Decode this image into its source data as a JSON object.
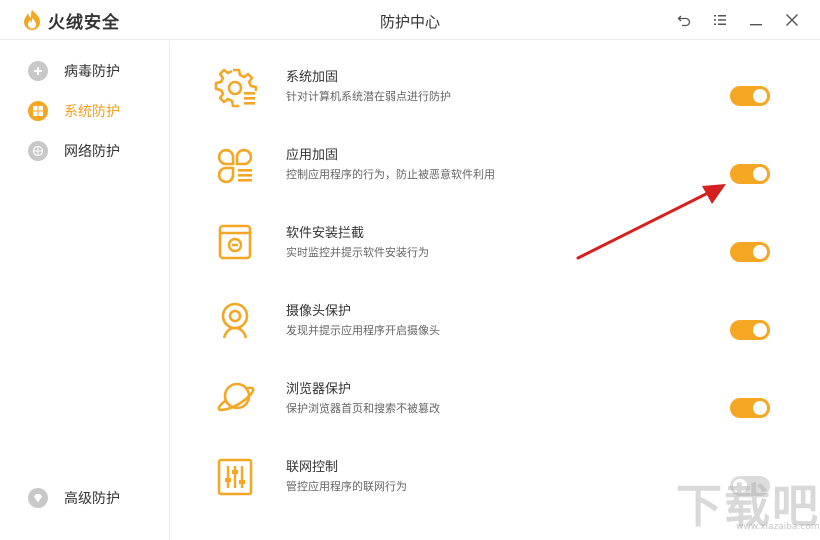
{
  "app": {
    "brand_name": "火绒安全",
    "window_title": "防护中心"
  },
  "window_controls": [
    {
      "name": "back-icon"
    },
    {
      "name": "menu-icon"
    },
    {
      "name": "minimize-icon"
    },
    {
      "name": "close-icon"
    }
  ],
  "sidebar": {
    "items": [
      {
        "label": "病毒防护",
        "icon": "virus-shield-icon",
        "active": false
      },
      {
        "label": "系统防护",
        "icon": "windows-icon",
        "active": true
      },
      {
        "label": "网络防护",
        "icon": "globe-icon",
        "active": false
      }
    ],
    "bottom_item": {
      "label": "高级防护",
      "icon": "diamond-icon"
    }
  },
  "features": [
    {
      "title": "系统加固",
      "desc": "针对计算机系统潜在弱点进行防护",
      "icon": "gear-list-icon",
      "enabled": true
    },
    {
      "title": "应用加固",
      "desc": "控制应用程序的行为，防止被恶意软件利用",
      "icon": "apps-icon",
      "enabled": true
    },
    {
      "title": "软件安装拦截",
      "desc": "实时监控并提示软件安装行为",
      "icon": "install-box-icon",
      "enabled": true
    },
    {
      "title": "摄像头保护",
      "desc": "发现并提示应用程序开启摄像头",
      "icon": "webcam-icon",
      "enabled": true
    },
    {
      "title": "浏览器保护",
      "desc": "保护浏览器首页和搜索不被篡改",
      "icon": "planet-icon",
      "enabled": true
    },
    {
      "title": "联网控制",
      "desc": "管控应用程序的联网行为",
      "icon": "sliders-icon",
      "enabled": false
    }
  ],
  "colors": {
    "accent": "#f5a623",
    "annotation": "#d42020"
  },
  "watermark": {
    "text": "下载吧",
    "sub": "www.xiazaiba.com"
  }
}
